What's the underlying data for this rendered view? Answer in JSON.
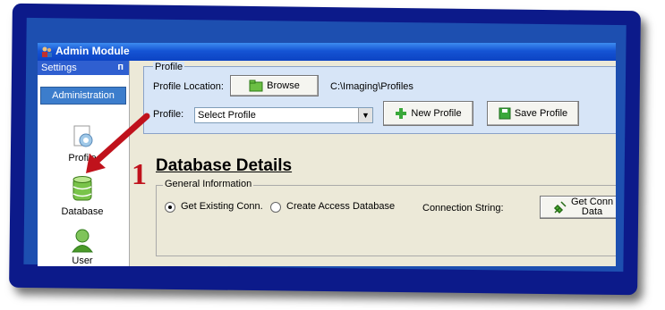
{
  "window": {
    "title": "Admin Module"
  },
  "sidebar": {
    "header": "Settings",
    "pin_glyph": "ᴨ",
    "tab": "Administration",
    "items": [
      {
        "label": "Profile",
        "icon": "profile-gear-icon"
      },
      {
        "label": "Database",
        "icon": "database-icon"
      },
      {
        "label": "User",
        "icon": "user-icon"
      }
    ]
  },
  "profile": {
    "legend": "Profile",
    "location_label": "Profile Location:",
    "browse_label": "Browse",
    "path": "C:\\Imaging\\Profiles",
    "profile_label": "Profile:",
    "select_value": "Select Profile",
    "new_profile_label": "New Profile",
    "save_profile_label": "Save Profile"
  },
  "database": {
    "title": "Database Details",
    "step_number": "1",
    "general_legend": "General Information",
    "radio_existing": "Get Existing Conn.",
    "radio_access": "Create Access Database",
    "connection_label": "Connection String:",
    "get_conn_line1": "Get Conn",
    "get_conn_line2": "Data"
  },
  "colors": {
    "frame": "#0c1a8a",
    "titlebar": "#1554d4",
    "panel": "#d7e5f7",
    "arrow": "#c0121c"
  }
}
